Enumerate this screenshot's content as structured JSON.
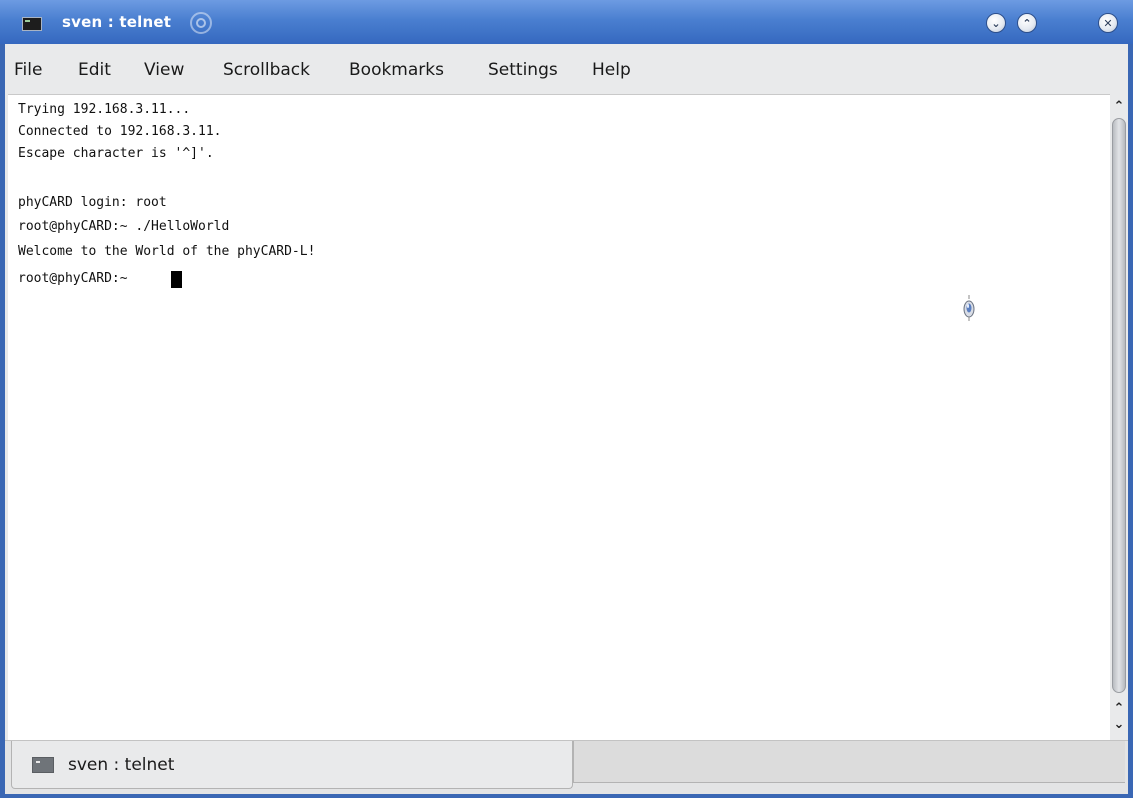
{
  "window": {
    "title": "sven : telnet"
  },
  "menu": {
    "items": [
      "File",
      "Edit",
      "View",
      "Scrollback",
      "Bookmarks",
      "Settings",
      "Help"
    ]
  },
  "terminal": {
    "lines": [
      "Trying 192.168.3.11...",
      "Connected to 192.168.3.11.",
      "Escape character is '^]'.",
      "",
      "phyCARD login: root",
      "root@phyCARD:~ ./HelloWorld",
      "Welcome to the World of the phyCARD-L!",
      "root@phyCARD:~ "
    ]
  },
  "tabs": [
    {
      "label": "sven : telnet",
      "active": true
    }
  ],
  "icons": {
    "app": "terminal-icon",
    "title_decoration": "swirl-icon",
    "minimize": "chevron-down-icon",
    "maximize": "chevron-up-icon",
    "close": "close-icon",
    "scroll_up": "chevron-up-icon",
    "scroll_down": "chevron-down-icon",
    "tab": "terminal-icon",
    "pointer": "mouse-pointer-icon"
  },
  "colors": {
    "titlebar": "#4a7fd0",
    "terminal_bg": "#ffffff",
    "terminal_text": "#111111"
  }
}
